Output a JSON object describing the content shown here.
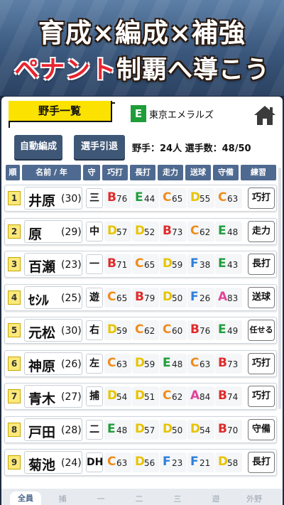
{
  "banner": {
    "line1": "育成×編成×補強",
    "line2_red": "ペナント",
    "line2_white": "制覇へ導こう"
  },
  "header": {
    "title": "野手一覧",
    "team_badge": "E",
    "team_name": "東京エメラルズ",
    "home_icon": "home-icon"
  },
  "buttons": {
    "auto": "自動編成",
    "retire": "選手引退"
  },
  "count": "野手：24人 選手数：48/50",
  "columns": [
    "順",
    "名前 / 年",
    "守",
    "巧打",
    "長打",
    "走力",
    "送球",
    "守備",
    "練習"
  ],
  "grade_colors": {
    "A": "#e0449a",
    "B": "#e02a2a",
    "C": "#f08b1a",
    "D": "#e8c400",
    "E": "#1f9d3a",
    "F": "#2d7fd9"
  },
  "players": [
    {
      "order": "1",
      "name": "井原",
      "age": "(30)",
      "pos": "三",
      "stats": [
        [
          "B",
          "76"
        ],
        [
          "E",
          "44"
        ],
        [
          "C",
          "65"
        ],
        [
          "D",
          "55"
        ],
        [
          "C",
          "63"
        ]
      ],
      "practice": "巧打"
    },
    {
      "order": "2",
      "name": "原",
      "age": "(29)",
      "pos": "中",
      "stats": [
        [
          "D",
          "57"
        ],
        [
          "D",
          "52"
        ],
        [
          "B",
          "73"
        ],
        [
          "C",
          "62"
        ],
        [
          "E",
          "48"
        ]
      ],
      "practice": "走力"
    },
    {
      "order": "3",
      "name": "百瀬",
      "age": "(23)",
      "pos": "一",
      "stats": [
        [
          "B",
          "71"
        ],
        [
          "C",
          "65"
        ],
        [
          "D",
          "59"
        ],
        [
          "F",
          "38"
        ],
        [
          "E",
          "43"
        ]
      ],
      "practice": "長打"
    },
    {
      "order": "4",
      "name": "ｾｼﾙ",
      "age": "(25)",
      "pos": "遊",
      "stats": [
        [
          "C",
          "65"
        ],
        [
          "B",
          "79"
        ],
        [
          "D",
          "50"
        ],
        [
          "F",
          "26"
        ],
        [
          "A",
          "83"
        ]
      ],
      "practice": "送球"
    },
    {
      "order": "5",
      "name": "元松",
      "age": "(30)",
      "pos": "右",
      "stats": [
        [
          "D",
          "59"
        ],
        [
          "C",
          "62"
        ],
        [
          "C",
          "60"
        ],
        [
          "B",
          "76"
        ],
        [
          "E",
          "49"
        ]
      ],
      "practice": "任せる"
    },
    {
      "order": "6",
      "name": "神原",
      "age": "(26)",
      "pos": "左",
      "stats": [
        [
          "C",
          "63"
        ],
        [
          "D",
          "59"
        ],
        [
          "E",
          "48"
        ],
        [
          "C",
          "63"
        ],
        [
          "B",
          "73"
        ]
      ],
      "practice": "巧打"
    },
    {
      "order": "7",
      "name": "青木",
      "age": "(27)",
      "pos": "捕",
      "stats": [
        [
          "D",
          "54"
        ],
        [
          "D",
          "51"
        ],
        [
          "C",
          "62"
        ],
        [
          "A",
          "84"
        ],
        [
          "B",
          "74"
        ]
      ],
      "practice": "巧打"
    },
    {
      "order": "8",
      "name": "戸田",
      "age": "(28)",
      "pos": "二",
      "stats": [
        [
          "E",
          "48"
        ],
        [
          "D",
          "57"
        ],
        [
          "D",
          "50"
        ],
        [
          "D",
          "54"
        ],
        [
          "B",
          "70"
        ]
      ],
      "practice": "守備"
    },
    {
      "order": "9",
      "name": "菊池",
      "age": "(24)",
      "pos": "DH",
      "stats": [
        [
          "C",
          "63"
        ],
        [
          "D",
          "56"
        ],
        [
          "F",
          "23"
        ],
        [
          "F",
          "21"
        ],
        [
          "D",
          "58"
        ]
      ],
      "practice": "長打"
    }
  ],
  "bottom_tabs": [
    "全員",
    "捕",
    "一",
    "二",
    "三",
    "遊",
    "外野"
  ]
}
